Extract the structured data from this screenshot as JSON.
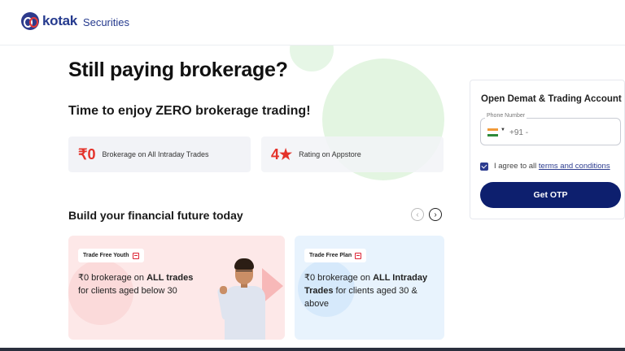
{
  "header": {
    "logo_word": "kotak",
    "logo_sub": "Securities"
  },
  "hero": {
    "headline": "Still paying brokerage?",
    "subhead": "Time to enjoy ZERO brokerage trading!"
  },
  "stats": [
    {
      "big": "₹0",
      "label": "Brokerage on All Intraday Trades"
    },
    {
      "big": "4★",
      "label": "Rating on Appstore"
    }
  ],
  "section": {
    "title": "Build your financial future today",
    "prev_icon": "chevron-left-icon",
    "next_icon": "chevron-right-icon"
  },
  "cards": [
    {
      "tag": "Trade Free Youth",
      "line1_pre": "₹0 brokerage on ",
      "line1_bold": "ALL trades",
      "line2": "for clients aged below 30"
    },
    {
      "tag": "Trade Free Plan",
      "line1_pre": "₹0 brokerage on ",
      "line1_bold": "ALL Intraday",
      "line2_bold": "Trades",
      "line2": " for clients aged 30 &",
      "line3": "above"
    }
  ],
  "panel": {
    "title": "Open Demat & Trading Account",
    "phone_label": "Phone Number",
    "country_code": "+91 -",
    "phone_value": "",
    "agree_text": "I agree to all ",
    "agree_link": "terms and conditions",
    "otp_button": "Get OTP"
  },
  "colors": {
    "brand_navy": "#0d1f6e",
    "accent_red": "#e4322a",
    "card_pink": "#fde8e8",
    "card_blue": "#e8f3fd"
  }
}
